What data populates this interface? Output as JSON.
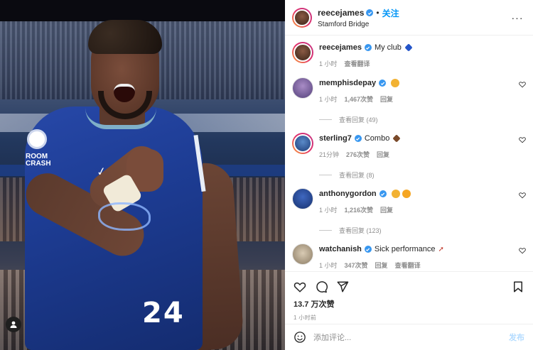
{
  "post": {
    "author": "reecejames",
    "follow_label": "关注",
    "location": "Stamford Bridge",
    "more_label": "···",
    "shirt_number": "24",
    "sleeve_text": "ROOM CRASH"
  },
  "caption": {
    "username": "reecejames",
    "text": "My club",
    "emoji": "blue-heart",
    "time": "1 小时",
    "translate": "查看翻译"
  },
  "comments": [
    {
      "username": "memphisdepay",
      "text": "",
      "emoji": "lion-face",
      "time": "1 小时",
      "likes": "1,467次赞",
      "reply": "回复",
      "view_replies": "查看回复 (49)"
    },
    {
      "username": "sterling7",
      "text": "Combo",
      "emoji": "brown-heart",
      "time": "21分钟",
      "likes": "276次赞",
      "reply": "回复",
      "view_replies": "查看回复 (8)"
    },
    {
      "username": "anthonygordon",
      "text": "",
      "emoji": "lion-face heart-eyes",
      "time": "1 小时",
      "likes": "1,216次赞",
      "reply": "回复",
      "view_replies": "查看回复 (123)"
    },
    {
      "username": "watchanish",
      "text": "Sick performance",
      "emoji": "rocket",
      "time": "1 小时",
      "likes": "347次赞",
      "reply": "回复",
      "translate": "查看翻译"
    }
  ],
  "stats": {
    "likes": "13.7 万次赞",
    "posted": "1 小时前"
  },
  "composer": {
    "placeholder": "添加评论...",
    "post_label": "发布"
  },
  "colors": {
    "accent": "#0095f6",
    "verified": "#3897f0",
    "muted": "#8e8e8e",
    "shirt": "#1d3c93"
  }
}
